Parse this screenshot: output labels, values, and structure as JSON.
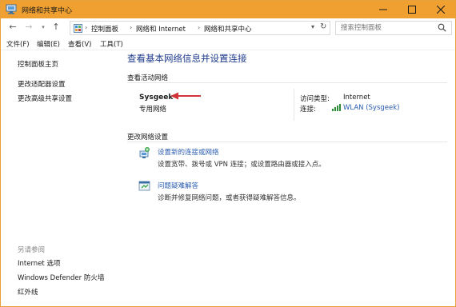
{
  "window": {
    "title": "网络和共享中心",
    "accent_color": "#f0a030",
    "controls": [
      "minimize-icon",
      "maximize-icon",
      "close-icon"
    ]
  },
  "address": {
    "crumbs": [
      "控制面板",
      "网络和 Internet",
      "网络和共享中心"
    ],
    "search_placeholder": "搜索控制面板"
  },
  "menu": {
    "file": "文件(F)",
    "edit": "编辑(E)",
    "view": "查看(V)",
    "tools": "工具(T)"
  },
  "sidebar": {
    "items": [
      "控制面板主页",
      "更改适配器设置",
      "更改高级共享设置"
    ],
    "see_also_title": "另请参阅",
    "see_also": [
      "Internet 选项",
      "Windows Defender 防火墙",
      "红外线"
    ]
  },
  "main": {
    "title": "查看基本网络信息并设置连接",
    "active_section": "查看活动网络",
    "network_name": "Sysgeek",
    "network_type": "专用网络",
    "access_type_label": "访问类型:",
    "access_type_value": "Internet",
    "connection_label": "连接:",
    "connection_value": "WLAN (Sysgeek)",
    "change_section": "更改网络设置",
    "tasks": [
      {
        "link": "设置新的连接或网络",
        "desc": "设置宽带、拨号或 VPN 连接；或设置路由器或接入点。",
        "icon": "network-setup-icon"
      },
      {
        "link": "问题疑难解答",
        "desc": "诊断并修复网络问题，或者获得疑难解答信息。",
        "icon": "troubleshoot-icon"
      }
    ]
  }
}
